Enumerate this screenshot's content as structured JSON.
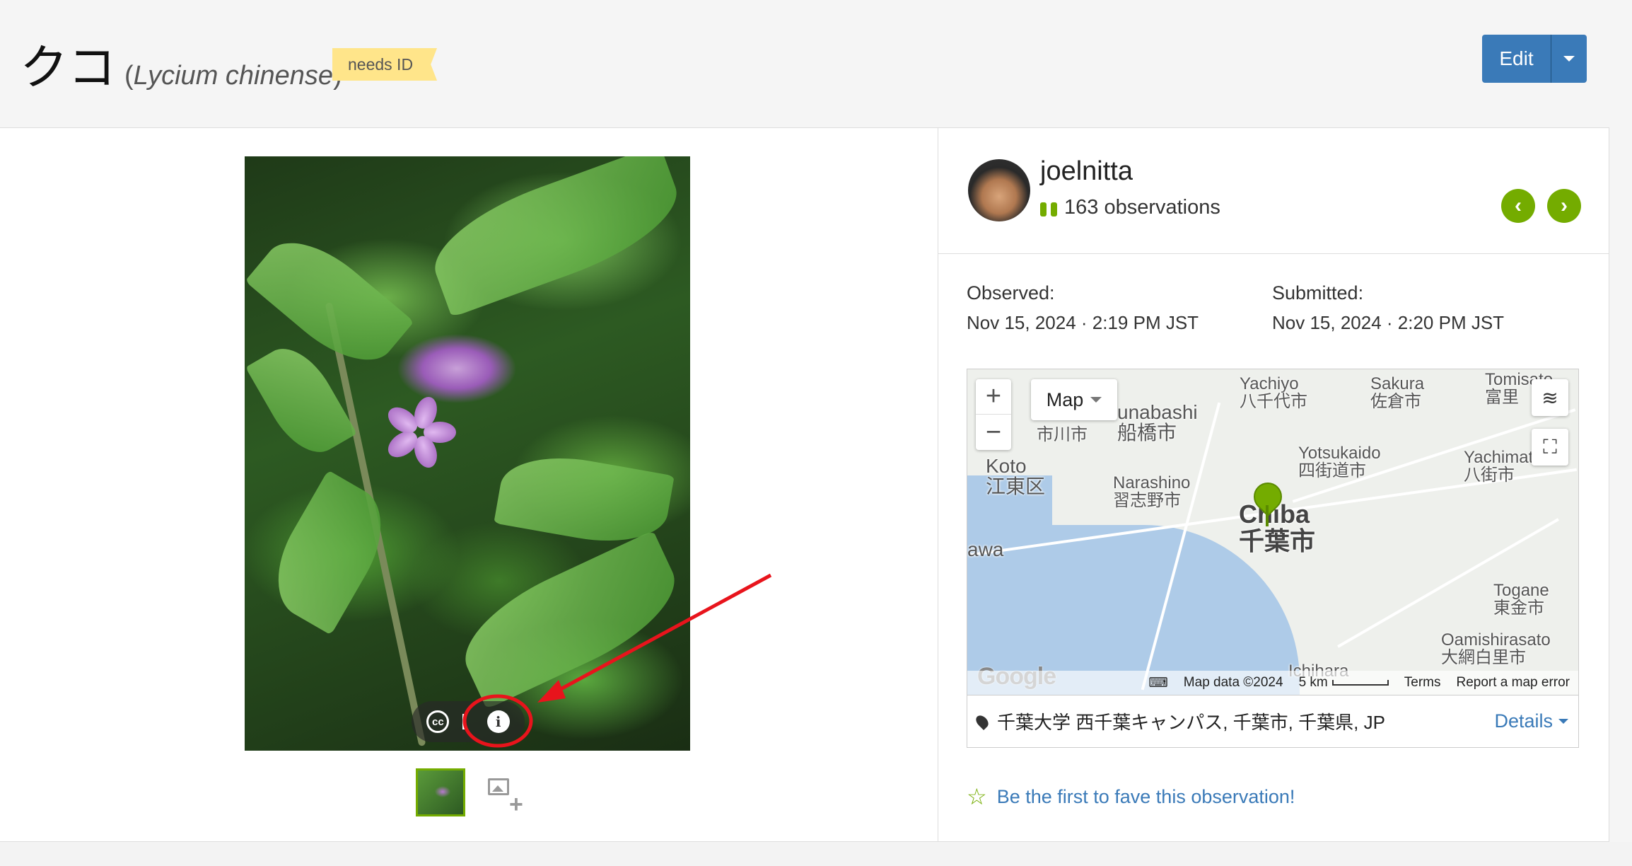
{
  "header": {
    "common_name": "クコ",
    "scientific_name": "Lycium chinense",
    "badge": "needs ID",
    "edit_label": "Edit"
  },
  "photo": {
    "controls": [
      "cc-icon",
      "flag-icon",
      "info-icon"
    ]
  },
  "observer": {
    "username": "joelnitta",
    "observations": "163 observations"
  },
  "dates": {
    "observed_label": "Observed:",
    "observed_value": "Nov 15, 2024 · 2:19 PM JST",
    "submitted_label": "Submitted:",
    "submitted_value": "Nov 15, 2024 · 2:20 PM JST"
  },
  "map": {
    "type_label": "Map",
    "zoom_in": "+",
    "zoom_out": "−",
    "cities": {
      "yachiyo": "Yachiyo\n八千代市",
      "sakura": "Sakura\n佐倉市",
      "tomisato": "Tomisato\n富里",
      "funabashi": "unabashi\n船橋市",
      "ichikawa": "市川市",
      "koto": "Koto\n江東区",
      "narashino": "Narashino\n習志野市",
      "yotsukaido": "Yotsukaido\n四街道市",
      "yachimata": "Yachimata\n八街市",
      "chiba": "Chiba\n千葉市",
      "togane": "Togane\n東金市",
      "oamishirasato": "Oamishirasato\n大網白里市",
      "ichihara": "Ichihara",
      "awa": "awa"
    },
    "footer": {
      "google": "Google",
      "map_data": "Map data ©2024",
      "scale": "5 km",
      "terms": "Terms",
      "report": "Report a map error"
    }
  },
  "location": {
    "place": "千葉大学 西千葉キャンパス, 千葉市, 千葉県, JP",
    "details_label": "Details"
  },
  "fave": {
    "label": "Be the first to fave this observation!"
  },
  "colors": {
    "accent_green": "#74ac00",
    "link_blue": "#3a7ab8",
    "badge_yellow": "#ffe58a",
    "annotation_red": "#e8141c"
  }
}
